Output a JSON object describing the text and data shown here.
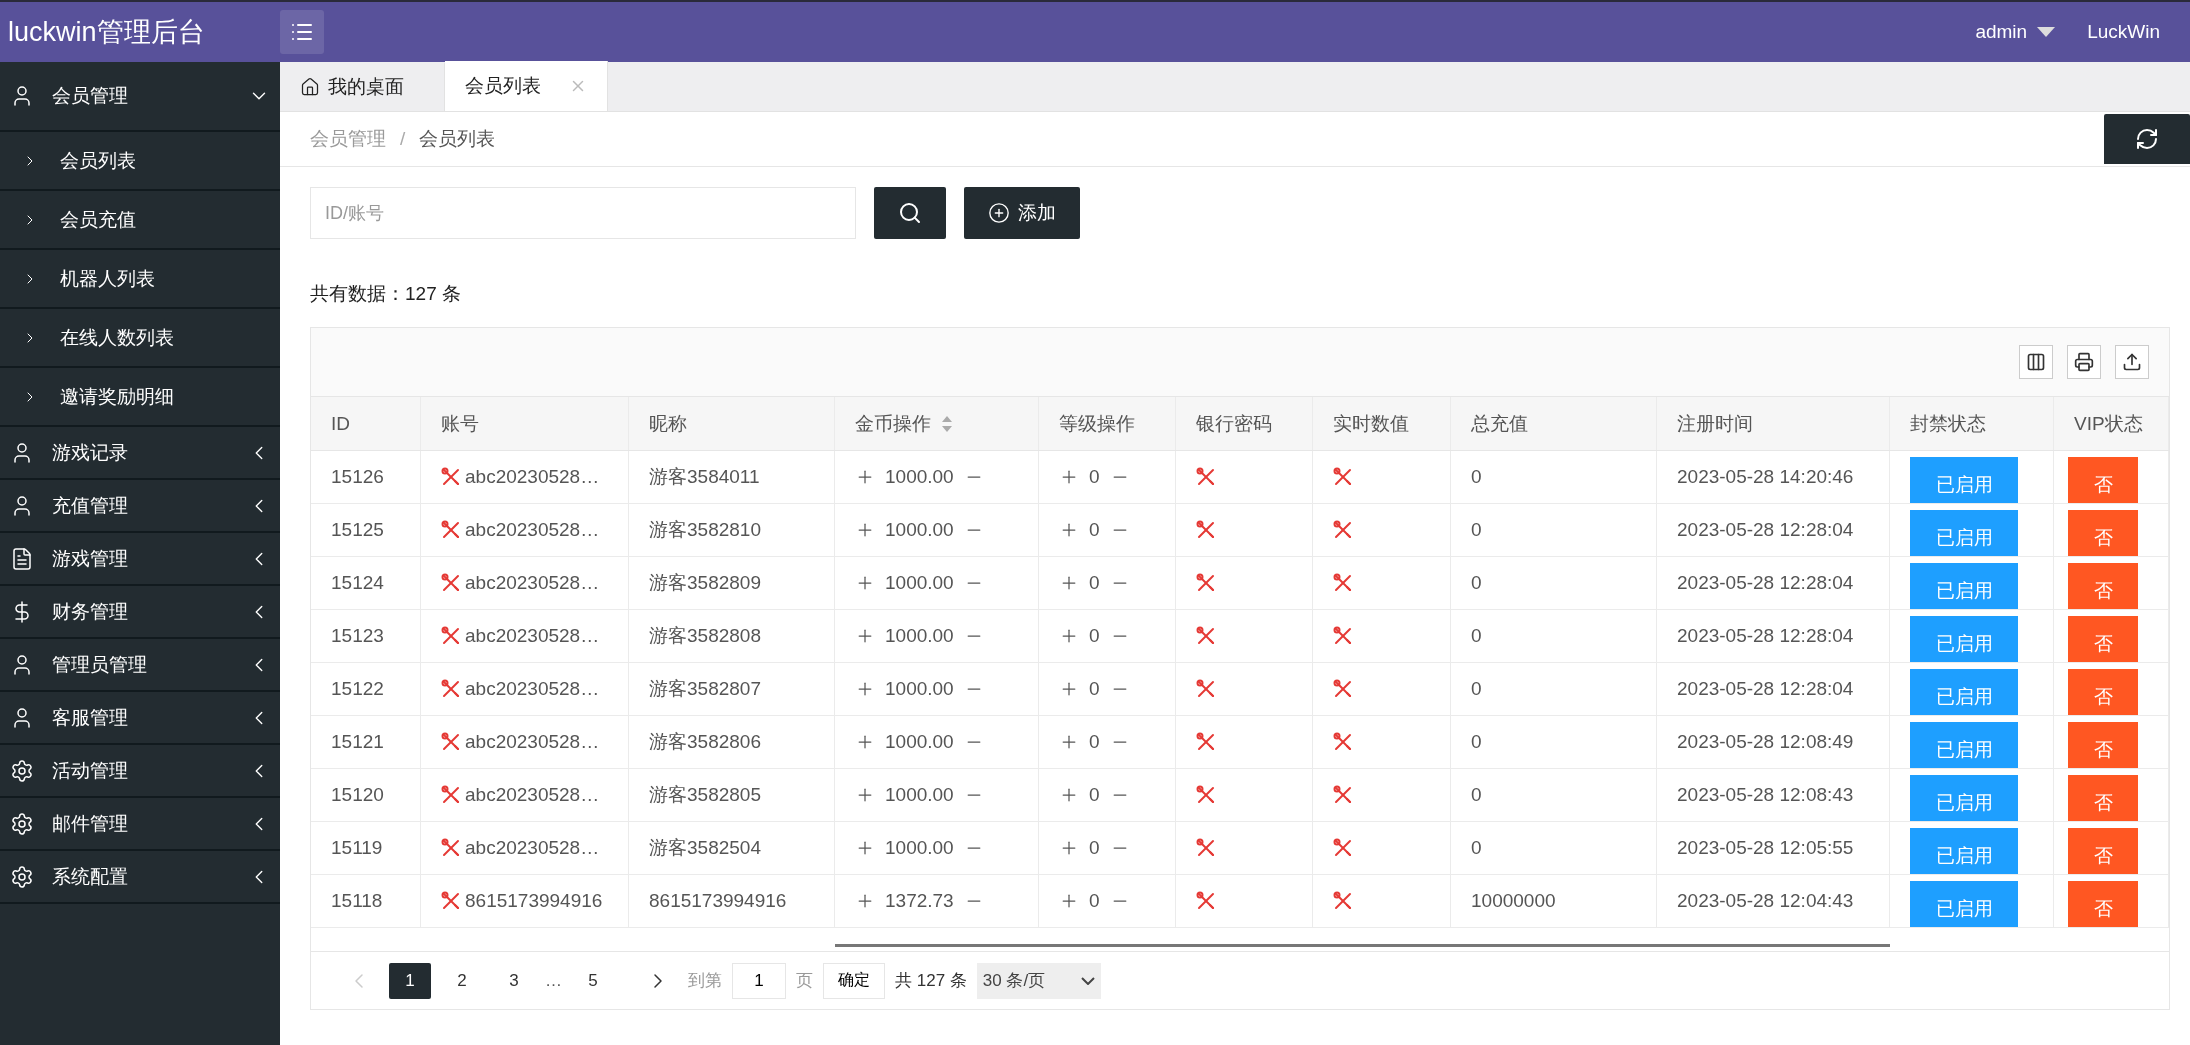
{
  "header": {
    "title": "luckwin管理后台",
    "user": "admin",
    "brand": "LuckWin"
  },
  "sidebar": {
    "items": [
      {
        "label": "会员管理",
        "expanded": true,
        "children": [
          {
            "label": "会员列表"
          },
          {
            "label": "会员充值"
          },
          {
            "label": "机器人列表"
          },
          {
            "label": "在线人数列表"
          },
          {
            "label": "邀请奖励明细"
          }
        ]
      },
      {
        "label": "游戏记录",
        "expanded": false
      },
      {
        "label": "充值管理",
        "expanded": false
      },
      {
        "label": "游戏管理",
        "expanded": false
      },
      {
        "label": "财务管理",
        "expanded": false
      },
      {
        "label": "管理员管理",
        "expanded": false
      },
      {
        "label": "客服管理",
        "expanded": false
      },
      {
        "label": "活动管理",
        "expanded": false
      },
      {
        "label": "邮件管理",
        "expanded": false
      },
      {
        "label": "系统配置",
        "expanded": false
      }
    ]
  },
  "tabs": [
    {
      "label": "我的桌面",
      "selected": false,
      "closable": false
    },
    {
      "label": "会员列表",
      "selected": true,
      "closable": true
    }
  ],
  "breadcrumb": {
    "items": [
      "会员管理",
      "会员列表"
    ],
    "separator": "/"
  },
  "search": {
    "placeholder": "ID/账号",
    "add_label": "添加"
  },
  "summary": "共有数据：127 条",
  "table": {
    "columns": [
      {
        "label": "ID",
        "sortable": false
      },
      {
        "label": "账号",
        "sortable": false
      },
      {
        "label": "昵称",
        "sortable": false
      },
      {
        "label": "金币操作",
        "sortable": true
      },
      {
        "label": "等级操作",
        "sortable": false
      },
      {
        "label": "银行密码",
        "sortable": false
      },
      {
        "label": "实时数值",
        "sortable": false
      },
      {
        "label": "总充值",
        "sortable": false
      },
      {
        "label": "注册时间",
        "sortable": false
      },
      {
        "label": "封禁状态",
        "sortable": false
      },
      {
        "label": "VIP状态",
        "sortable": false
      }
    ],
    "rows": [
      {
        "id": "15126",
        "account": "abc20230528…",
        "nickname": "游客3584011",
        "gold": "1000.00",
        "level": "0",
        "total": "0",
        "registered": "2023-05-28 14:20:46",
        "ban": "已启用",
        "vip": "否"
      },
      {
        "id": "15125",
        "account": "abc20230528…",
        "nickname": "游客3582810",
        "gold": "1000.00",
        "level": "0",
        "total": "0",
        "registered": "2023-05-28 12:28:04",
        "ban": "已启用",
        "vip": "否"
      },
      {
        "id": "15124",
        "account": "abc20230528…",
        "nickname": "游客3582809",
        "gold": "1000.00",
        "level": "0",
        "total": "0",
        "registered": "2023-05-28 12:28:04",
        "ban": "已启用",
        "vip": "否"
      },
      {
        "id": "15123",
        "account": "abc20230528…",
        "nickname": "游客3582808",
        "gold": "1000.00",
        "level": "0",
        "total": "0",
        "registered": "2023-05-28 12:28:04",
        "ban": "已启用",
        "vip": "否"
      },
      {
        "id": "15122",
        "account": "abc20230528…",
        "nickname": "游客3582807",
        "gold": "1000.00",
        "level": "0",
        "total": "0",
        "registered": "2023-05-28 12:28:04",
        "ban": "已启用",
        "vip": "否"
      },
      {
        "id": "15121",
        "account": "abc20230528…",
        "nickname": "游客3582806",
        "gold": "1000.00",
        "level": "0",
        "total": "0",
        "registered": "2023-05-28 12:08:49",
        "ban": "已启用",
        "vip": "否"
      },
      {
        "id": "15120",
        "account": "abc20230528…",
        "nickname": "游客3582805",
        "gold": "1000.00",
        "level": "0",
        "total": "0",
        "registered": "2023-05-28 12:08:43",
        "ban": "已启用",
        "vip": "否"
      },
      {
        "id": "15119",
        "account": "abc20230528…",
        "nickname": "游客3582504",
        "gold": "1000.00",
        "level": "0",
        "total": "0",
        "registered": "2023-05-28 12:05:55",
        "ban": "已启用",
        "vip": "否"
      },
      {
        "id": "15118",
        "account": "8615173994916",
        "nickname": "8615173994916",
        "gold": "1372.73",
        "level": "0",
        "total": "10000000",
        "registered": "2023-05-28 12:04:43",
        "ban": "已启用",
        "vip": "否"
      }
    ]
  },
  "pagination": {
    "prev_disabled": true,
    "pages": [
      {
        "label": "1",
        "kind": "page",
        "selected": true
      },
      {
        "label": "2",
        "kind": "page",
        "selected": false
      },
      {
        "label": "3",
        "kind": "page",
        "selected": false
      },
      {
        "label": "…",
        "kind": "ellipsis"
      },
      {
        "label": "5",
        "kind": "page",
        "selected": false
      }
    ],
    "goto_label": "到第",
    "goto_value": "1",
    "page_unit": "页",
    "confirm": "确定",
    "total": "共 127 条",
    "page_size": "30 条/页"
  }
}
